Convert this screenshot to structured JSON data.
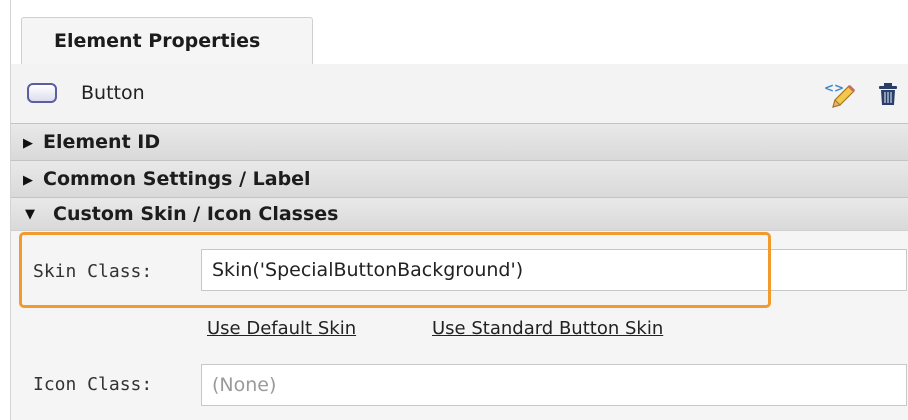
{
  "tab": {
    "label": "Element Properties"
  },
  "element": {
    "type_label": "Button",
    "edit_icon": "edit-code-icon",
    "delete_icon": "trash-icon"
  },
  "sections": [
    {
      "label": "Element ID",
      "expanded": false,
      "arrow": "▶"
    },
    {
      "label": "Common Settings / Label",
      "expanded": false,
      "arrow": "▶"
    },
    {
      "label": "Custom Skin / Icon Classes",
      "expanded": true,
      "arrow": "▼"
    }
  ],
  "skin": {
    "label": "Skin Class:",
    "value": "Skin('SpecialButtonBackground')",
    "link_default": "Use Default Skin",
    "link_standard": "Use Standard Button Skin"
  },
  "icon": {
    "label": "Icon Class:",
    "placeholder": "(None)"
  },
  "colors": {
    "highlight": "#f39a2c",
    "section_bg": "#dedede",
    "panel_bg": "#f5f5f5"
  }
}
